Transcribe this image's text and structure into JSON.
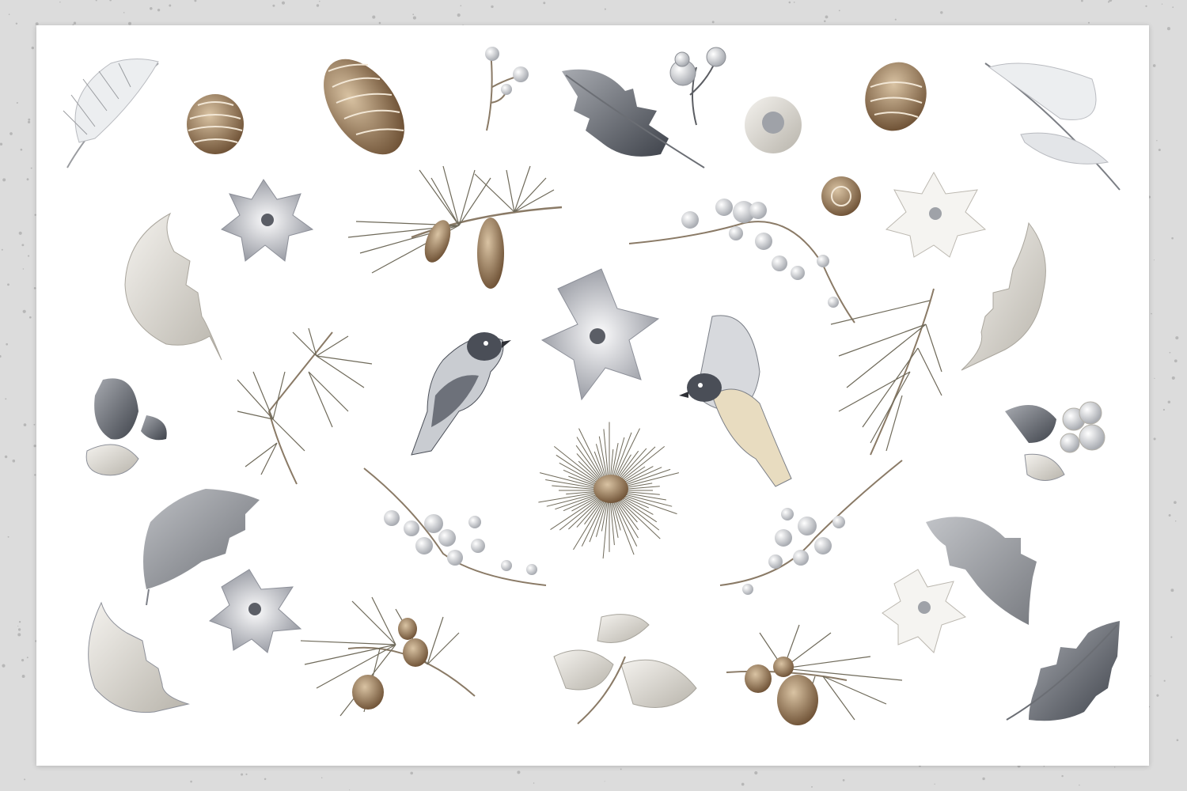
{
  "title": "",
  "palette": {
    "background": "#dcdcdc",
    "sheet": "#ffffff",
    "cone": "#8a6a48",
    "needle": "#6f6a5a",
    "leaf_grey": "#7d8088",
    "leaf_light": "#d9d6cf",
    "berry": "#e8e8ea",
    "bird_dark": "#4a4e57"
  },
  "elements": [
    {
      "kind": "feather",
      "name": "feather-top-left"
    },
    {
      "kind": "pinecone",
      "name": "pinecone-small-top"
    },
    {
      "kind": "pinecone",
      "name": "pinecone-long-top"
    },
    {
      "kind": "berries",
      "name": "berry-sprig-top"
    },
    {
      "kind": "holly-leaf",
      "name": "holly-leaf-dark-top"
    },
    {
      "kind": "berries",
      "name": "berry-cluster-top"
    },
    {
      "kind": "flower",
      "name": "dandelion-flower"
    },
    {
      "kind": "pinecone",
      "name": "pinecone-top-right"
    },
    {
      "kind": "feather",
      "name": "feather-top-right"
    },
    {
      "kind": "poinsettia",
      "name": "poinsettia-left"
    },
    {
      "kind": "pine-branch",
      "name": "pine-branch-cones-top"
    },
    {
      "kind": "berries",
      "name": "berry-branch-right"
    },
    {
      "kind": "pinecone",
      "name": "pinecone-round-mid"
    },
    {
      "kind": "poinsettia",
      "name": "poinsettia-right"
    },
    {
      "kind": "holly-leaf",
      "name": "leaf-curled-left"
    },
    {
      "kind": "holly-leaf",
      "name": "leaf-curled-right"
    },
    {
      "kind": "poinsettia",
      "name": "poinsettia-center"
    },
    {
      "kind": "bird",
      "name": "bird-perched"
    },
    {
      "kind": "bird",
      "name": "bird-flying"
    },
    {
      "kind": "pine-branch",
      "name": "pine-branch-left"
    },
    {
      "kind": "pine-branch",
      "name": "pine-sprig-right"
    },
    {
      "kind": "holly-leaf",
      "name": "leaf-pair-left"
    },
    {
      "kind": "berries",
      "name": "leaf-berries-right"
    },
    {
      "kind": "pine-wreath",
      "name": "pine-burst-center"
    },
    {
      "kind": "berries",
      "name": "berry-branch-lower-left"
    },
    {
      "kind": "berries",
      "name": "berry-branch-lower-right"
    },
    {
      "kind": "holly-leaf",
      "name": "holly-leaf-lower-left"
    },
    {
      "kind": "holly-leaf",
      "name": "holly-leaf-lower-right"
    },
    {
      "kind": "poinsettia",
      "name": "poinsettia-lower-left"
    },
    {
      "kind": "poinsettia",
      "name": "poinsettia-lower-right"
    },
    {
      "kind": "holly-leaf",
      "name": "leaf-curled-bottom-left"
    },
    {
      "kind": "pine-branch",
      "name": "pine-branch-cones-bottom-left"
    },
    {
      "kind": "holly-leaf",
      "name": "leaf-trio-bottom"
    },
    {
      "kind": "pine-branch",
      "name": "pine-branch-cones-bottom-right"
    },
    {
      "kind": "holly-leaf",
      "name": "holly-leaf-dark-bottom"
    }
  ]
}
